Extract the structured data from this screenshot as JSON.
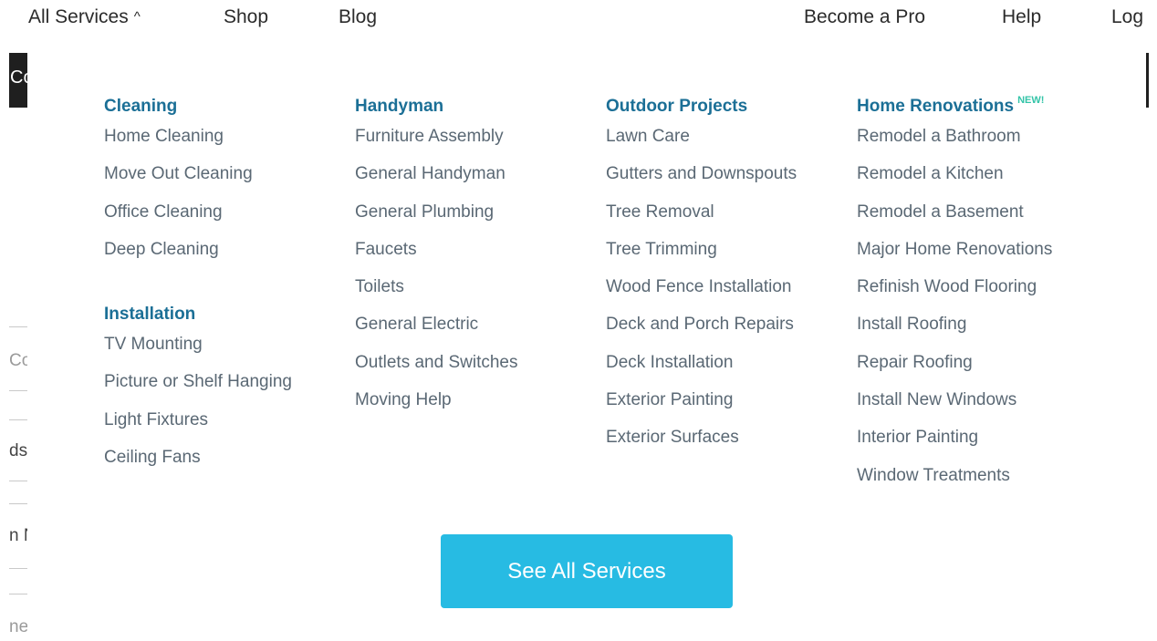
{
  "nav": {
    "all_services": "All Services",
    "shop": "Shop",
    "blog": "Blog",
    "become_pro": "Become a Pro",
    "help": "Help",
    "login": "Log"
  },
  "background": {
    "frag1": "Co",
    "frag2": "Co",
    "frag3": "ds",
    "frag4": "n N",
    "frag5": "ne"
  },
  "menu": {
    "cleaning": {
      "title": "Cleaning",
      "items": [
        "Home Cleaning",
        "Move Out Cleaning",
        "Office Cleaning",
        "Deep Cleaning"
      ]
    },
    "installation": {
      "title": "Installation",
      "items": [
        "TV Mounting",
        "Picture or Shelf Hanging",
        "Light Fixtures",
        "Ceiling Fans"
      ]
    },
    "handyman": {
      "title": "Handyman",
      "items": [
        "Furniture Assembly",
        "General Handyman",
        "General Plumbing",
        "Faucets",
        "Toilets",
        "General Electric",
        "Outlets and Switches",
        "Moving Help"
      ]
    },
    "outdoor": {
      "title": "Outdoor Projects",
      "items": [
        "Lawn Care",
        "Gutters and Downspouts",
        "Tree Removal",
        "Tree Trimming",
        "Wood Fence Installation",
        "Deck and Porch Repairs",
        "Deck Installation",
        "Exterior Painting",
        "Exterior Surfaces"
      ]
    },
    "renovations": {
      "title": "Home Renovations",
      "badge": "NEW!",
      "items": [
        "Remodel a Bathroom",
        "Remodel a Kitchen",
        "Remodel a Basement",
        "Major Home Renovations",
        "Refinish Wood Flooring",
        "Install Roofing",
        "Repair Roofing",
        "Install New Windows",
        "Interior Painting",
        "Window Treatments"
      ]
    }
  },
  "cta": {
    "label": "See All Services"
  },
  "colors": {
    "heading": "#1b6f96",
    "item": "#5a6874",
    "cta": "#27bbe3",
    "badge": "#34c4a8"
  }
}
